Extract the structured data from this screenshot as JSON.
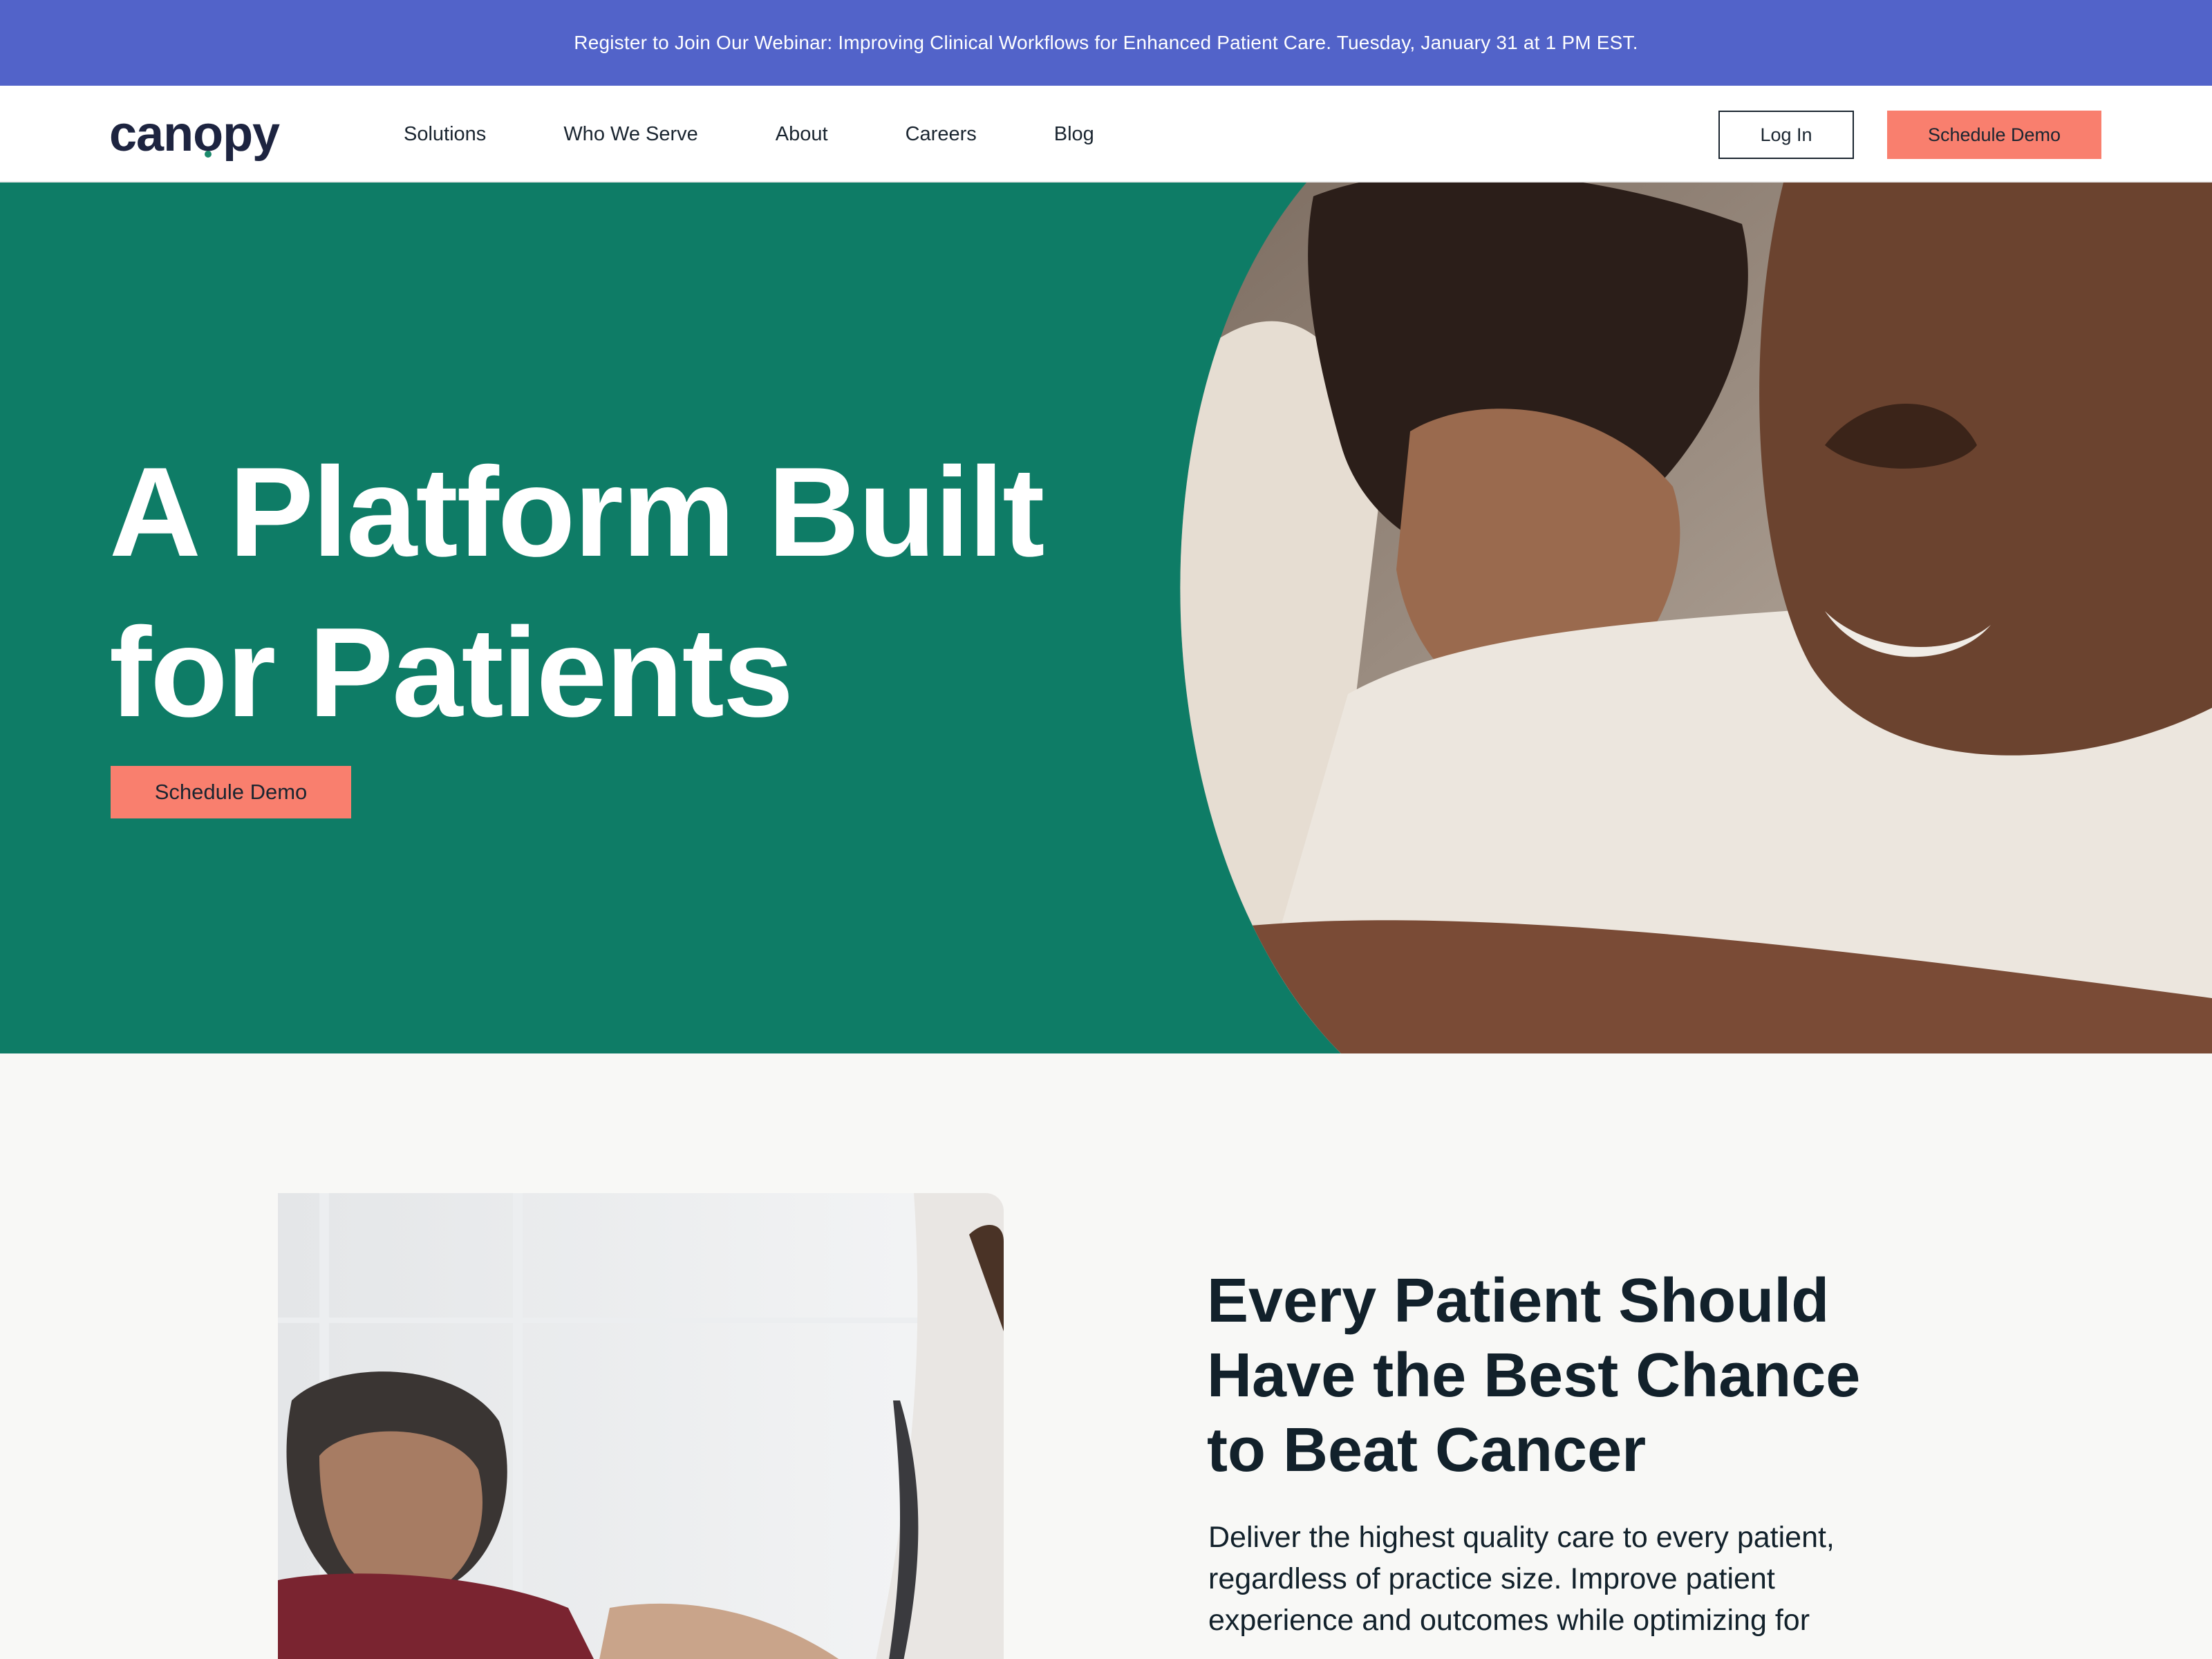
{
  "announcement": {
    "text": "Register to Join Our Webinar: Improving Clinical Workflows for Enhanced Patient Care. Tuesday, January 31 at 1 PM EST."
  },
  "nav": {
    "logo": {
      "prefix": "can",
      "o": "o",
      "suffix": "py"
    },
    "items": [
      {
        "label": "Solutions"
      },
      {
        "label": "Who We Serve"
      },
      {
        "label": "About"
      },
      {
        "label": "Careers"
      },
      {
        "label": "Blog"
      }
    ],
    "login_label": "Log In",
    "demo_label": "Schedule Demo"
  },
  "hero": {
    "title_lines": [
      "A Platform Built",
      "for Patients"
    ],
    "cta_label": "Schedule Demo"
  },
  "feature": {
    "heading_lines": [
      "Every Patient Should",
      "Have the Best Chance",
      "to Beat Cancer"
    ],
    "body_lines": [
      "Deliver the highest quality care to every patient,",
      "regardless of practice size. Improve patient",
      "experience and outcomes while optimizing for"
    ]
  },
  "colors": {
    "announcement_bg": "#5263c9",
    "hero_green": "#0e7c66",
    "coral_accent": "#f97f6e",
    "navy_text": "#12212b",
    "page_bg": "#f8f8f6"
  }
}
